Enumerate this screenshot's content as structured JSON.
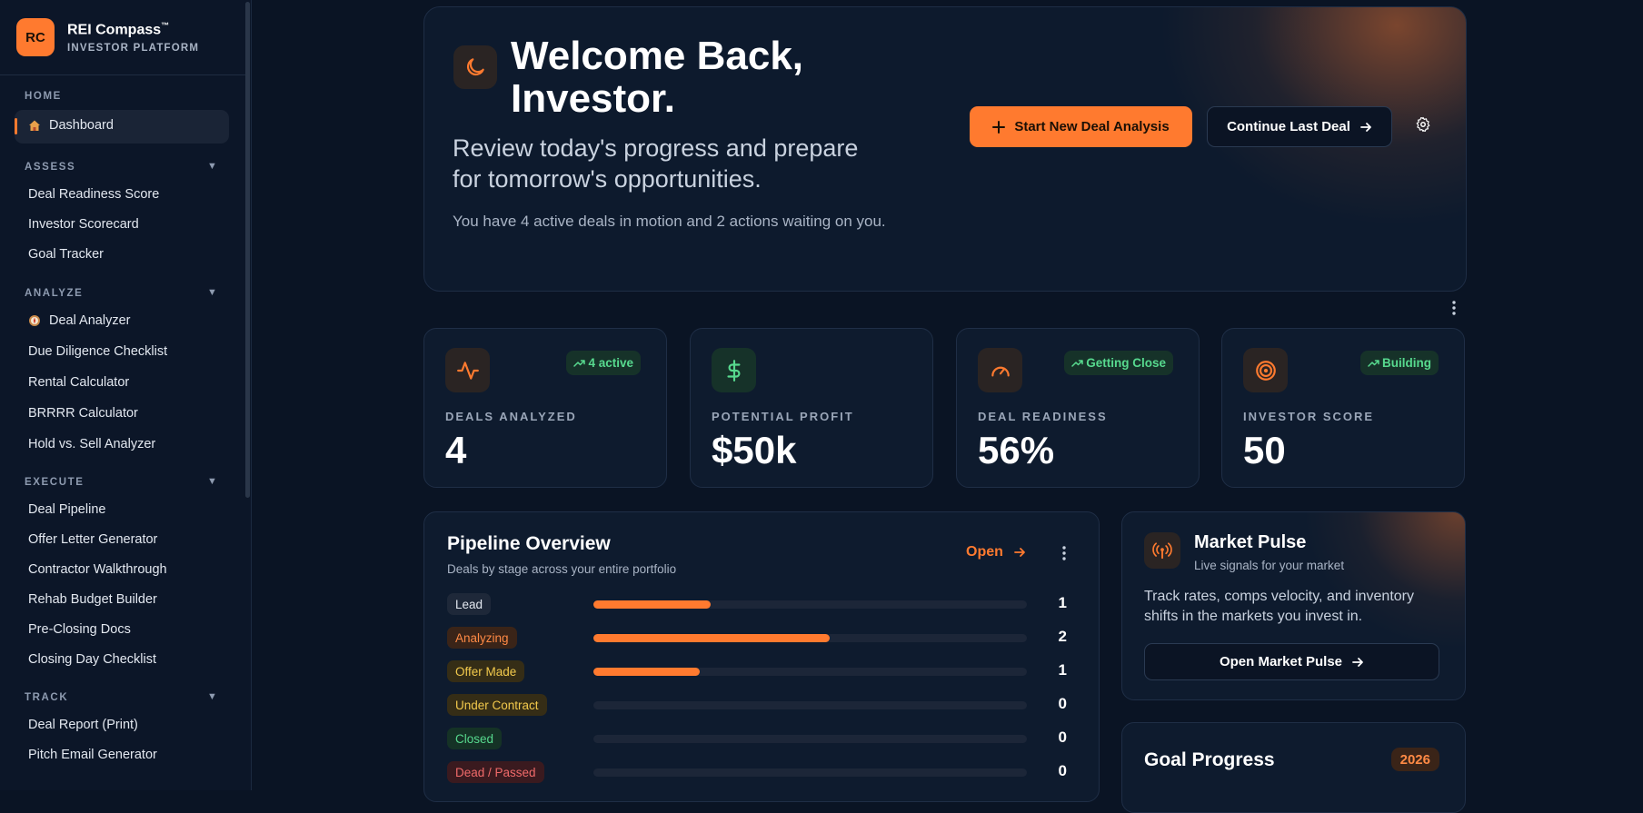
{
  "brand": {
    "logo": "RC",
    "name": "REI Compass",
    "tm": "™",
    "subtitle": "INVESTOR PLATFORM"
  },
  "sidebar": {
    "sections": [
      {
        "title": "HOME",
        "items": [
          {
            "label": "Dashboard",
            "icon": "house-icon",
            "active": true
          }
        ]
      },
      {
        "title": "ASSESS",
        "items": [
          {
            "label": "Deal Readiness Score"
          },
          {
            "label": "Investor Scorecard"
          },
          {
            "label": "Goal Tracker"
          }
        ]
      },
      {
        "title": "ANALYZE",
        "items": [
          {
            "label": "Deal Analyzer",
            "icon": "compass-icon"
          },
          {
            "label": "Due Diligence Checklist"
          },
          {
            "label": "Rental Calculator"
          },
          {
            "label": "BRRRR Calculator"
          },
          {
            "label": "Hold vs. Sell Analyzer"
          }
        ]
      },
      {
        "title": "EXECUTE",
        "items": [
          {
            "label": "Deal Pipeline"
          },
          {
            "label": "Offer Letter Generator"
          },
          {
            "label": "Contractor Walkthrough"
          },
          {
            "label": "Rehab Budget Builder"
          },
          {
            "label": "Pre-Closing Docs"
          },
          {
            "label": "Closing Day Checklist"
          }
        ]
      },
      {
        "title": "TRACK",
        "items": [
          {
            "label": "Deal Report (Print)"
          },
          {
            "label": "Pitch Email Generator"
          }
        ]
      }
    ],
    "caret": "▼"
  },
  "hero": {
    "title": "Welcome Back, Investor.",
    "subtitle": "Review today's progress and prepare for tomorrow's opportunities.",
    "description": "You have 4 active deals in motion and 2 actions waiting on you.",
    "primary_button": "Start New Deal Analysis",
    "secondary_button": "Continue Last Deal"
  },
  "kpis": [
    {
      "label": "DEALS ANALYZED",
      "value": "4",
      "badge": "4 active",
      "icon": "activity-icon"
    },
    {
      "label": "POTENTIAL PROFIT",
      "value": "$50k",
      "badge": "",
      "icon": "dollar-icon"
    },
    {
      "label": "DEAL READINESS",
      "value": "56%",
      "badge": "Getting Close",
      "icon": "gauge-icon"
    },
    {
      "label": "INVESTOR SCORE",
      "value": "50",
      "badge": "Building",
      "icon": "target-icon"
    }
  ],
  "pipeline": {
    "title": "Pipeline Overview",
    "subtitle": "Deals by stage across your entire portfolio",
    "open_label": "Open",
    "stages": [
      {
        "label": "Lead",
        "count": "1",
        "fill": 0.27,
        "tag_bg": "#1e2839",
        "tag_fg": "#e3e8f0"
      },
      {
        "label": "Analyzing",
        "count": "2",
        "fill": 0.545,
        "tag_bg": "#3a2418",
        "tag_fg": "#ff8a45"
      },
      {
        "label": "Offer Made",
        "count": "1",
        "fill": 0.245,
        "tag_bg": "#352d16",
        "tag_fg": "#f2c94c"
      },
      {
        "label": "Under Contract",
        "count": "0",
        "fill": 0,
        "tag_bg": "#352d16",
        "tag_fg": "#f2c94c"
      },
      {
        "label": "Closed",
        "count": "0",
        "fill": 0,
        "tag_bg": "#153226",
        "tag_fg": "#57d98e"
      },
      {
        "label": "Dead / Passed",
        "count": "0",
        "fill": 0,
        "tag_bg": "#3a1a1f",
        "tag_fg": "#f06a6a"
      }
    ]
  },
  "market": {
    "title": "Market Pulse",
    "subtitle": "Live signals for your market",
    "description": "Track rates, comps velocity, and inventory shifts in the markets you invest in.",
    "button": "Open Market Pulse"
  },
  "goal": {
    "title": "Goal Progress",
    "year": "2026"
  },
  "colors": {
    "accent": "#ff7a2f",
    "success": "#57d98e",
    "bg": "#0a1424"
  }
}
